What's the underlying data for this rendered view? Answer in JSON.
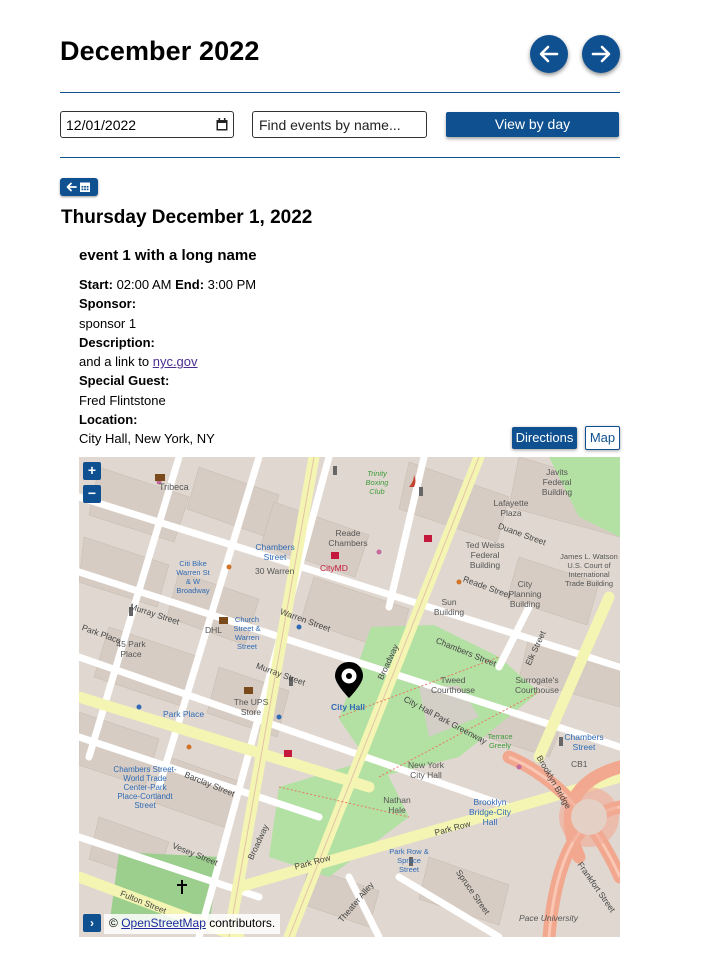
{
  "header": {
    "title": "December 2022",
    "prev_icon": "arrow-left-icon",
    "next_icon": "arrow-right-icon"
  },
  "filters": {
    "date_value": "12/01/2022",
    "date_icon": "calendar-icon",
    "search_placeholder": "Find events by name...",
    "view_button": "View by day"
  },
  "back_to_calendar_icon": "arrow-left-calendar-icon",
  "day": {
    "heading": "Thursday December 1, 2022",
    "event": {
      "name": "event 1 with a long name",
      "start_label": "Start:",
      "start": "02:00 AM",
      "end_label": "End:",
      "end": "3:00 PM",
      "sponsor_label": "Sponsor:",
      "sponsor": "sponsor 1",
      "description_label": "Description:",
      "description_text": "and a link to ",
      "description_link": "nyc.gov",
      "guest_label": "Special Guest:",
      "guest": "Fred Flintstone",
      "location_label": "Location:",
      "location": "City Hall, New York, NY",
      "directions_button": "Directions",
      "map_button": "Map"
    }
  },
  "map": {
    "zoom_in": "+",
    "zoom_out": "−",
    "attribution_toggle": "›",
    "attribution_prefix": "© ",
    "attribution_link": "OpenStreetMap",
    "attribution_suffix": " contributors.",
    "marker_label": "City Hall",
    "labels": {
      "tribeca": "Tribeca",
      "trinity": "Trinity Boxing Club",
      "reade_chambers": "Reade Chambers",
      "chambers_street": "Chambers Street",
      "warren30": "30 Warren",
      "citymd": "CityMD",
      "citibike": "Citi Bike Warren St & W Broadway",
      "ted_weiss": "Ted Weiss Federal Building",
      "javits": "Javits Federal Building",
      "lafayette": "Lafayette Plaza",
      "duane": "Duane Street",
      "reade_street": "Reade Street",
      "city_planning": "City Planning Building",
      "sun_building": "Sun Building",
      "watson": "James L. Watson U.S. Court of International Trade Building",
      "murray": "Murray Street",
      "warren_street": "Warren Street",
      "church_warren": "Church Street & Warren Street",
      "dhl": "DHL",
      "park_place_45": "45 Park Place",
      "park_place": "Park Place",
      "ups": "The UPS Store",
      "tweed": "Tweed Courthouse",
      "surrogates": "Surrogate's Courthouse",
      "elk": "Elk Street",
      "chambers_street_2": "Chambers Street",
      "city_hall_greenway": "City Hall Park Greenway",
      "terrace_greely": "Terrace Greely",
      "ny_city_hall": "New York City Hall",
      "nathan_hale": "Nathan Hale",
      "brooklyn_bridge_cityhall": "Brooklyn Bridge-City Hall",
      "brooklyn_bridge": "Brooklyn Bridge",
      "chambers_world_trade": "Chambers Street-World Trade Center-Park Place-Cortlandt Street",
      "barclay": "Barclay Street",
      "vesey": "Vesey Street",
      "park_row": "Park Row",
      "park_row_spruce": "Park Row & Spruce Street",
      "spruce": "Spruce Street",
      "theater_alley": "Theater Alley",
      "frankfort": "Frankfort Street",
      "fulton": "Fulton Street",
      "pace": "Pace University",
      "broadway": "Broadway",
      "cb1": "CB1"
    }
  },
  "colors": {
    "primary": "#0f5190",
    "link": "#4b2d8f",
    "map_building": "#d9d0c9",
    "map_park": "#aee1a0",
    "map_major_road": "#f7f9ba",
    "map_highway": "#f5ab92"
  }
}
